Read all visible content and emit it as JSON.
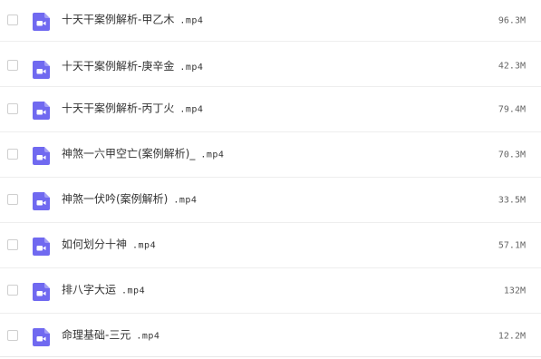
{
  "icon": {
    "name": "video-file-icon",
    "color": "#7069f0"
  },
  "files": [
    {
      "name": "十天干案例解析-甲乙木",
      "ext": ".mp4",
      "size": "96.3M"
    },
    {
      "name": "十天干案例解析-庚辛金",
      "ext": ".mp4",
      "size": "42.3M"
    },
    {
      "name": "十天干案例解析-丙丁火",
      "ext": ".mp4",
      "size": "79.4M"
    },
    {
      "name": "神煞一六甲空亡(案例解析)_",
      "ext": ".mp4",
      "size": "70.3M"
    },
    {
      "name": "神煞一伏吟(案例解析)",
      "ext": ".mp4",
      "size": "33.5M"
    },
    {
      "name": "如何划分十神",
      "ext": ".mp4",
      "size": "57.1M"
    },
    {
      "name": "排八字大运",
      "ext": ".mp4",
      "size": "132M"
    },
    {
      "name": "命理基础-三元",
      "ext": ".mp4",
      "size": "12.2M"
    }
  ]
}
